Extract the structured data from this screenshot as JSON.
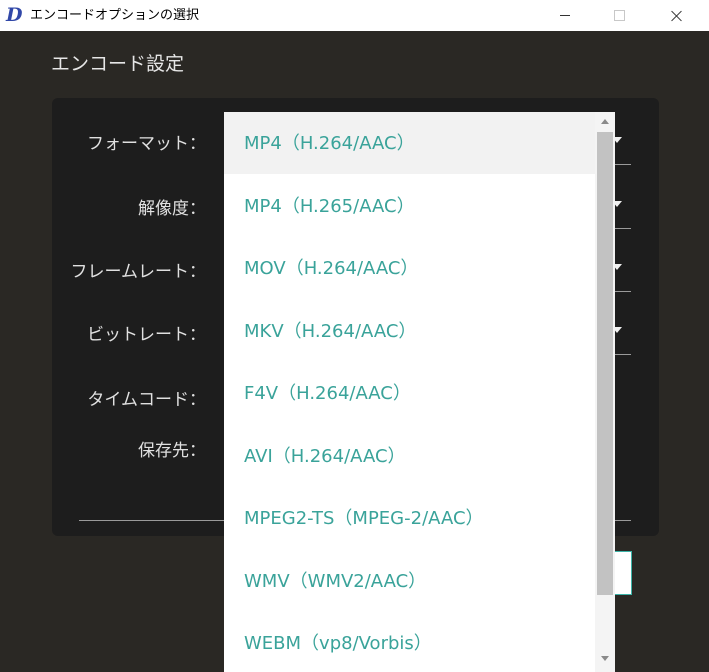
{
  "window": {
    "title": "エンコードオプションの選択",
    "app_icon": "D"
  },
  "section_title": "エンコード設定",
  "form_labels": {
    "format": "フォーマット：",
    "resolution": "解像度：",
    "frame_rate": "フレームレート：",
    "bit_rate": "ビットレート：",
    "timecode": "タイムコード：",
    "save_to": "保存先："
  },
  "format_dropdown": {
    "selected_index": 0,
    "options": [
      "MP4（H.264/AAC）",
      "MP4（H.265/AAC）",
      "MOV（H.264/AAC）",
      "MKV（H.264/AAC）",
      "F4V（H.264/AAC）",
      "AVI（H.264/AAC）",
      "MPEG2-TS（MPEG-2/AAC）",
      "WMV（WMV2/AAC）",
      "WEBM（vp8/Vorbis）"
    ]
  },
  "colors": {
    "dialog_background": "#2a2824",
    "panel_background": "#1d1d1d",
    "option_text": "#3aa39a",
    "selected_row": "#f2f2f2"
  }
}
